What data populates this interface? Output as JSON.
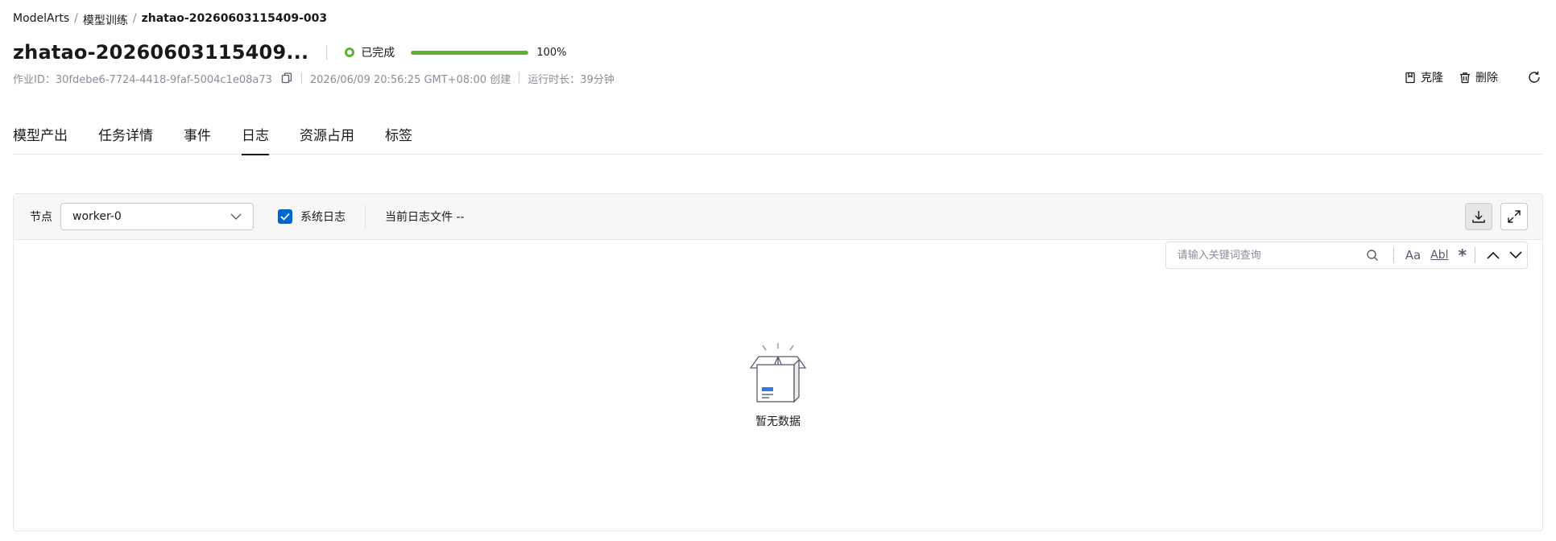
{
  "breadcrumb": {
    "items": [
      "ModelArts",
      "模型训练",
      "zhatao-20260603115409-003"
    ],
    "separator": "/"
  },
  "job": {
    "title": "zhatao-20260603115409...",
    "status": "已完成",
    "progress_percent": 100,
    "progress_label": "100%",
    "status_color": "#5eb233"
  },
  "meta": {
    "job_id": "作业ID：30fdebe6-7724-4418-9faf-5004c1e08a73",
    "created": "2026/06/09 20:56:25 GMT+08:00 创建",
    "duration": "运行时长：39分钟"
  },
  "actions": {
    "clone": "克隆",
    "delete": "删除"
  },
  "tabs": [
    {
      "label": "模型产出",
      "active": false
    },
    {
      "label": "任务详情",
      "active": false
    },
    {
      "label": "事件",
      "active": false
    },
    {
      "label": "日志",
      "active": true
    },
    {
      "label": "资源占用",
      "active": false
    },
    {
      "label": "标签",
      "active": false
    }
  ],
  "log_panel": {
    "node_label": "节点",
    "node_value": "worker-0",
    "system_log_label": "系统日志",
    "system_log_checked": true,
    "current_file": "当前日志文件 --",
    "search_placeholder": "请输入关键词查询",
    "opt_case": "Aa",
    "opt_word": "Abl",
    "opt_regex": "*",
    "empty_text": "暂无数据"
  },
  "colors": {
    "accent": "#0067d1",
    "success": "#5eb233"
  }
}
